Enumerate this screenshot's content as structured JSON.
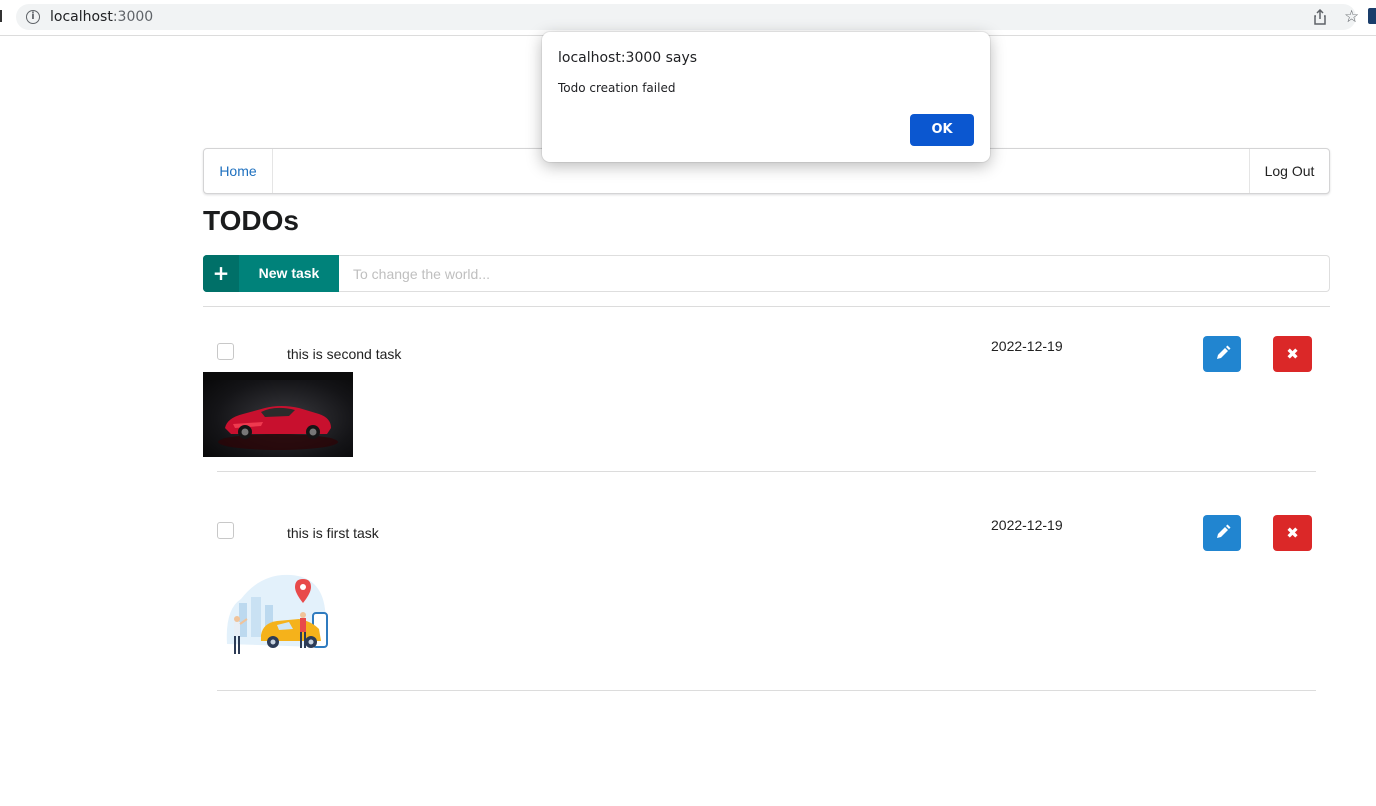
{
  "browser": {
    "host": "localhost",
    "port": ":3000",
    "info_icon": "i",
    "share_icon": "share-icon",
    "star_icon": "☆"
  },
  "nav": {
    "home_label": "Home",
    "logout_label": "Log Out"
  },
  "page": {
    "title": "TODOs"
  },
  "new_task": {
    "plus": "+",
    "label": "New task",
    "placeholder": "To change the world..."
  },
  "todos": [
    {
      "text": "this is second task",
      "date": "2022-12-19",
      "image": "red sports car"
    },
    {
      "text": "this is first task",
      "date": "2022-12-19",
      "image": "taxi illustration"
    }
  ],
  "icons": {
    "edit": "pencil-icon",
    "delete": "✖"
  },
  "dialog": {
    "title": "localhost:3000 says",
    "message": "Todo creation failed",
    "ok_label": "OK"
  },
  "colors": {
    "new_task": "#00827a",
    "edit": "#2185d0",
    "delete": "#db2828",
    "link": "#1e70bf",
    "dialog_ok": "#0b57d0"
  }
}
